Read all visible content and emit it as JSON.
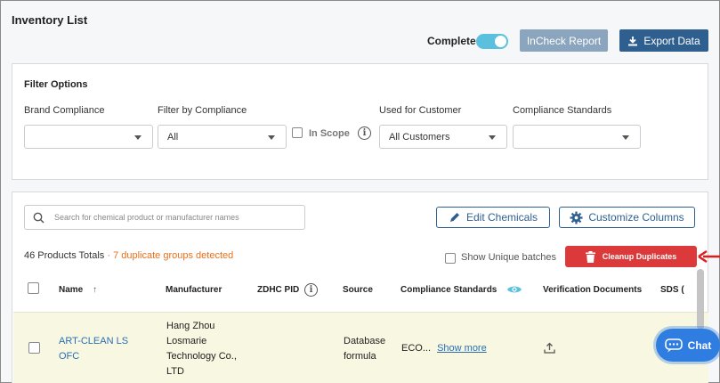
{
  "header": {
    "title": "Inventory List",
    "toggle_label": "Complete",
    "toggle_on": true,
    "incheck_label": "InCheck Report",
    "export_label": "Export Data"
  },
  "filters": {
    "title": "Filter Options",
    "brand_label": "Brand Compliance",
    "brand_value": "",
    "compliance_label": "Filter by Compliance",
    "compliance_value": "All",
    "in_scope_label": "In Scope",
    "customer_label": "Used for Customer",
    "customer_value": "All Customers",
    "standards_label": "Compliance Standards",
    "standards_value": ""
  },
  "toolbar": {
    "search_placeholder": "Search for chemical product or manufacturer names",
    "edit_label": "Edit Chemicals",
    "customize_label": "Customize Columns",
    "totals": "46 Products Totals",
    "separator": " · ",
    "duplicates": "7 duplicate groups detected",
    "unique_label": "Show Unique batches",
    "cleanup_label": "Cleanup Duplicates"
  },
  "table": {
    "columns": [
      "Name",
      "Manufacturer",
      "ZDHC PID",
      "Source",
      "Compliance Standards",
      "Verification Documents",
      "SDS ("
    ],
    "rows": [
      {
        "name_line1": "ART-CLEAN LS",
        "name_line2": "OFC",
        "manufacturer": [
          "Hang Zhou",
          "Losmarie",
          "Technology Co.,",
          "LTD"
        ],
        "zdhc_pid": "",
        "source_line1": "Database",
        "source_line2": "formula",
        "standards": "ECO...",
        "show_more": "Show more"
      }
    ]
  },
  "chat": {
    "label": "Chat"
  },
  "colors": {
    "accent": "#2f5f8f",
    "toggle": "#5bc0de",
    "danger": "#dc3a3a",
    "warning": "#e8701a",
    "link": "#2a6fb3"
  }
}
